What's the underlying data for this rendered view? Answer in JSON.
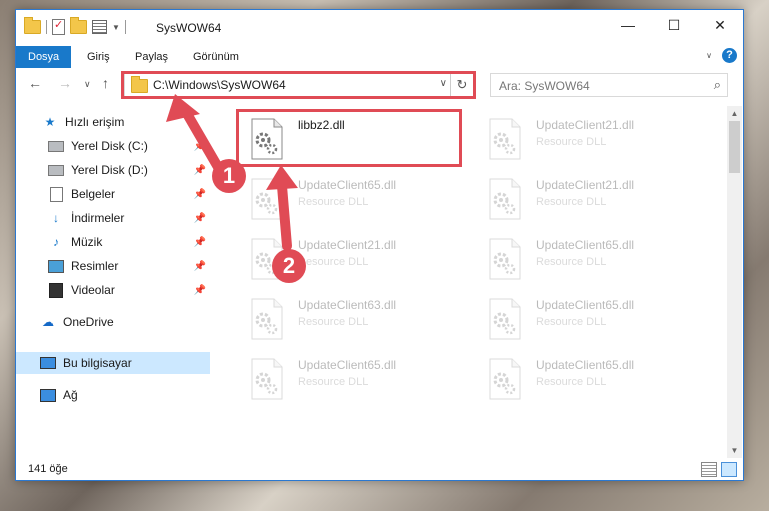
{
  "window": {
    "title": "SysWOW64"
  },
  "ribbon": {
    "tabs": [
      "Dosya",
      "Giriş",
      "Paylaş",
      "Görünüm"
    ],
    "help": "?"
  },
  "address": {
    "path": "C:\\Windows\\SysWOW64"
  },
  "search": {
    "placeholder": "Ara: SysWOW64"
  },
  "sidebar": {
    "quick_access": "Hızlı erişim",
    "items": [
      {
        "label": "Yerel Disk (C:)"
      },
      {
        "label": "Yerel Disk (D:)"
      },
      {
        "label": "Belgeler"
      },
      {
        "label": "İndirmeler"
      },
      {
        "label": "Müzik"
      },
      {
        "label": "Resimler"
      },
      {
        "label": "Videolar"
      }
    ],
    "onedrive": "OneDrive",
    "this_pc": "Bu bilgisayar",
    "network": "Ağ"
  },
  "files": [
    {
      "name": "libbz2.dll",
      "type": ""
    },
    {
      "name": "UpdateClient21.dll",
      "type": "Resource DLL"
    },
    {
      "name": "UpdateClient65.dll",
      "type": "Resource DLL"
    },
    {
      "name": "UpdateClient21.dll",
      "type": "Resource DLL"
    },
    {
      "name": "UpdateClient21.dll",
      "type": "Resource DLL"
    },
    {
      "name": "UpdateClient65.dll",
      "type": "Resource DLL"
    },
    {
      "name": "UpdateClient63.dll",
      "type": "Resource DLL"
    },
    {
      "name": "UpdateClient65.dll",
      "type": "Resource DLL"
    },
    {
      "name": "UpdateClient65.dll",
      "type": "Resource DLL"
    },
    {
      "name": "UpdateClient65.dll",
      "type": "Resource DLL"
    }
  ],
  "status": {
    "count": "141 öğe"
  },
  "callouts": [
    "1",
    "2"
  ],
  "colors": {
    "accent": "#1979ca",
    "annotation": "#e04b55",
    "selection": "#cce8ff"
  }
}
